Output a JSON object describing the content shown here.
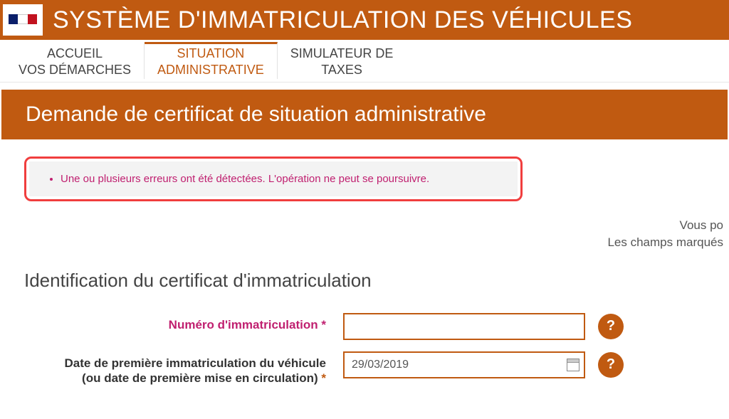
{
  "header": {
    "site_title": "SYSTÈME D'IMMATRICULATION DES VÉHICULES"
  },
  "nav": {
    "items": [
      {
        "line1": "ACCUEIL",
        "line2": "VOS DÉMARCHES",
        "active": false
      },
      {
        "line1": "SITUATION",
        "line2": "ADMINISTRATIVE",
        "active": true
      },
      {
        "line1": "SIMULATEUR DE",
        "line2": "TAXES",
        "active": false
      }
    ]
  },
  "page": {
    "title": "Demande de certificat de situation administrative"
  },
  "alert": {
    "messages": [
      "Une ou plusieurs erreurs ont été détectées. L'opération ne peut se poursuivre."
    ]
  },
  "hints": {
    "line1": "Vous po",
    "line2": "Les champs marqués"
  },
  "section": {
    "heading": "Identification du certificat d'immatriculation"
  },
  "form": {
    "immat": {
      "label": "Numéro d'immatriculation",
      "value": "",
      "error": true
    },
    "date": {
      "label_line1": "Date de première immatriculation du véhicule",
      "label_line2": "(ou date de première mise en circulation)",
      "value": "29/03/2019",
      "error": false
    },
    "required_mark": "*",
    "help_label": "?"
  }
}
